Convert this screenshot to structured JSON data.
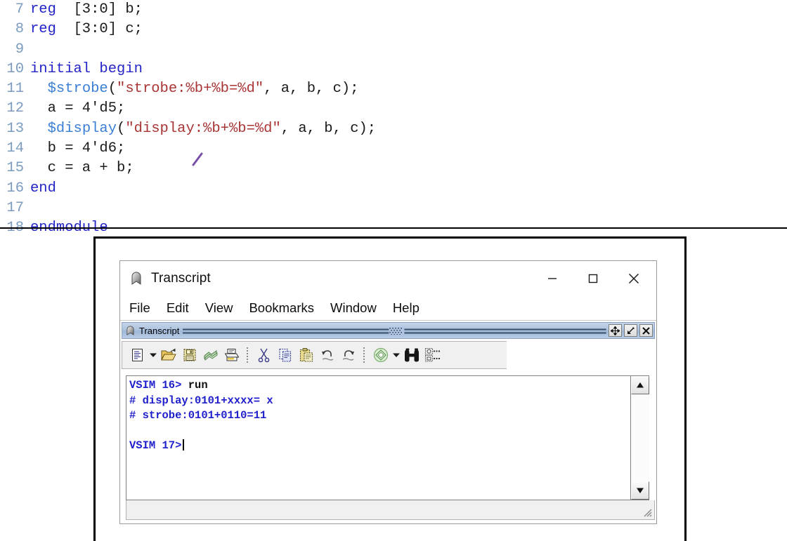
{
  "code_editor": {
    "lines": [
      {
        "num": "7",
        "tokens": [
          {
            "t": "reg",
            "c": "kw"
          },
          {
            "t": "  [3:0] b;",
            "c": "plain"
          }
        ]
      },
      {
        "num": "8",
        "tokens": [
          {
            "t": "reg",
            "c": "kw"
          },
          {
            "t": "  [3:0] c;",
            "c": "plain"
          }
        ]
      },
      {
        "num": "9",
        "tokens": []
      },
      {
        "num": "10",
        "tokens": [
          {
            "t": "initial begin",
            "c": "kw"
          }
        ]
      },
      {
        "num": "11",
        "tokens": [
          {
            "t": "  ",
            "c": "plain"
          },
          {
            "t": "$strobe",
            "c": "sysfn"
          },
          {
            "t": "(",
            "c": "plain"
          },
          {
            "t": "\"strobe:%b+%b=%d\"",
            "c": "str"
          },
          {
            "t": ", a, b, c);",
            "c": "plain"
          }
        ]
      },
      {
        "num": "12",
        "tokens": [
          {
            "t": "  a = 4'd5;",
            "c": "plain"
          }
        ]
      },
      {
        "num": "13",
        "tokens": [
          {
            "t": "  ",
            "c": "plain"
          },
          {
            "t": "$display",
            "c": "sysfn"
          },
          {
            "t": "(",
            "c": "plain"
          },
          {
            "t": "\"display:%b+%b=%d\"",
            "c": "str"
          },
          {
            "t": ", a, b, c);",
            "c": "plain"
          }
        ]
      },
      {
        "num": "14",
        "tokens": [
          {
            "t": "  b = 4'd6;",
            "c": "plain"
          }
        ]
      },
      {
        "num": "15",
        "tokens": [
          {
            "t": "  c = a + b;",
            "c": "plain"
          }
        ]
      },
      {
        "num": "16",
        "tokens": [
          {
            "t": "end",
            "c": "kw"
          }
        ]
      },
      {
        "num": "17",
        "tokens": []
      },
      {
        "num": "18",
        "tokens": [
          {
            "t": "endmodule",
            "c": "kw"
          }
        ]
      }
    ]
  },
  "window": {
    "title": "Transcript",
    "app_icon": "transcript-bookmark-icon",
    "caption_buttons": [
      {
        "name": "minimize",
        "glyph": "—"
      },
      {
        "name": "maximize",
        "glyph": "☐"
      },
      {
        "name": "close",
        "glyph": "✕"
      }
    ],
    "menu": [
      {
        "label": "File"
      },
      {
        "label": "Edit"
      },
      {
        "label": "View"
      },
      {
        "label": "Bookmarks"
      },
      {
        "label": "Window"
      },
      {
        "label": "Help"
      }
    ]
  },
  "mdi": {
    "title": "Transcript",
    "icon": "transcript-bookmark-icon",
    "buttons": [
      {
        "name": "undock-button",
        "icon": "move-arrows-icon"
      },
      {
        "name": "dock-button",
        "icon": "arrow-into-corner-icon"
      },
      {
        "name": "close-button",
        "icon": "close-x-icon"
      }
    ]
  },
  "toolbar": {
    "items": [
      {
        "name": "new-document-button",
        "icon": "new-document-icon"
      },
      {
        "name": "new-document-dropdown",
        "icon": "chevron-down-icon"
      },
      {
        "name": "open-button",
        "icon": "open-folder-icon"
      },
      {
        "name": "save-button",
        "icon": "save-disk-icon"
      },
      {
        "name": "reload-button",
        "icon": "reload-icon"
      },
      {
        "name": "print-button",
        "icon": "printer-icon"
      },
      {
        "name": "separator-1",
        "icon": "separator"
      },
      {
        "name": "cut-button",
        "icon": "scissors-icon"
      },
      {
        "name": "copy-button",
        "icon": "copy-icon"
      },
      {
        "name": "paste-button",
        "icon": "paste-icon"
      },
      {
        "name": "undo-button",
        "icon": "undo-arrow-icon"
      },
      {
        "name": "redo-button",
        "icon": "redo-arrow-icon"
      },
      {
        "name": "separator-2",
        "icon": "separator"
      },
      {
        "name": "compile-button",
        "icon": "green-diamond-icon"
      },
      {
        "name": "compile-dropdown",
        "icon": "chevron-down-icon"
      },
      {
        "name": "find-button",
        "icon": "binoculars-icon"
      },
      {
        "name": "find-in-files-button",
        "icon": "find-in-files-icon"
      }
    ]
  },
  "console": {
    "lines": [
      {
        "prompt": "VSIM 16>",
        "command": " run",
        "output": ""
      },
      {
        "prompt": "",
        "command": "",
        "output": "# display:0101+xxxx= x"
      },
      {
        "prompt": "",
        "command": "",
        "output": "# strobe:0101+0110=11"
      },
      {
        "prompt": "",
        "command": "",
        "output": ""
      },
      {
        "prompt": "VSIM 17>",
        "command": "",
        "output": "",
        "caret": true
      }
    ],
    "scrollbar": {
      "up_glyph": "▲",
      "down_glyph": "▼"
    }
  },
  "colors": {
    "keyword_blue": "#2424c8",
    "system_task_blue": "#3a7fd5",
    "string_red": "#a93535",
    "line_number": "#7b9bbf",
    "console_blue": "#2020cc",
    "mdi_titlebar": "#aec4e0"
  }
}
